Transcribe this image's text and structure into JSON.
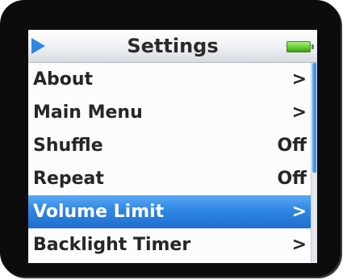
{
  "header": {
    "title": "Settings",
    "left_icon": "play-icon",
    "right_icon": "battery-icon",
    "accent_color": "#2f86e3",
    "battery_color": "#5fcb2d"
  },
  "menu": {
    "items": [
      {
        "label": "About",
        "value": ">",
        "selected": false
      },
      {
        "label": "Main Menu",
        "value": ">",
        "selected": false
      },
      {
        "label": "Shuffle",
        "value": "Off",
        "selected": false
      },
      {
        "label": "Repeat",
        "value": "Off",
        "selected": false
      },
      {
        "label": "Volume Limit",
        "value": ">",
        "selected": true
      },
      {
        "label": "Backlight Timer",
        "value": ">",
        "selected": false
      }
    ],
    "selection_color": "#2f86e3"
  },
  "scrollbar": {
    "thumb_start_fraction": 0.0,
    "thumb_size_fraction": 0.55
  }
}
